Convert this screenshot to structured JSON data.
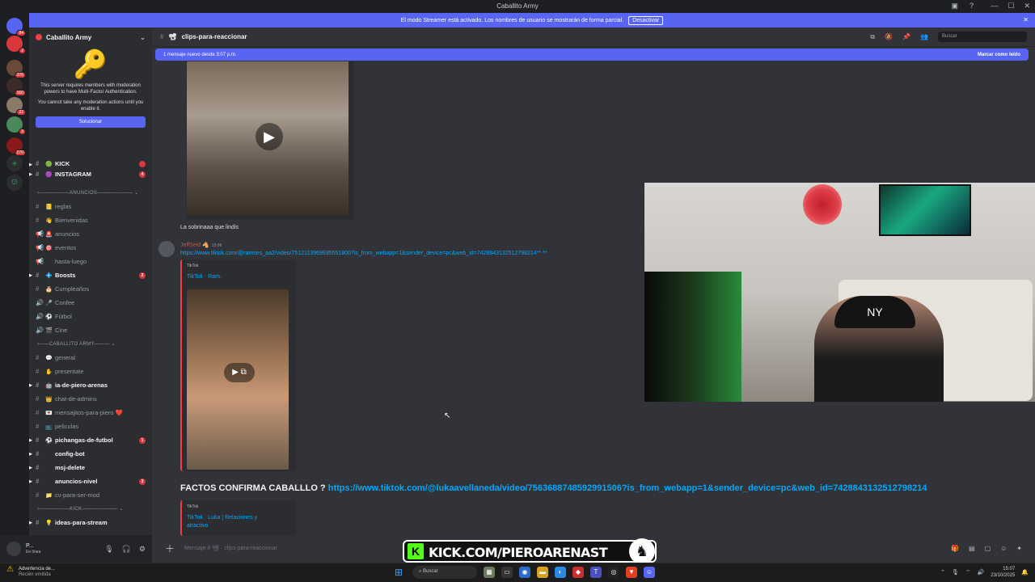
{
  "window": {
    "title": "Caballito Army"
  },
  "streamer_banner": {
    "text": "El modo Streamer está activado. Los nombres de usuario se mostrarán de forma parcial.",
    "button": "Desactivar"
  },
  "servers": [
    {
      "badge": "84"
    },
    {
      "badge": "2"
    },
    {
      "badge": "376"
    },
    {
      "badge": "160"
    },
    {
      "badge": "22"
    },
    {
      "badge": "3"
    },
    {
      "badge": "270"
    }
  ],
  "sidebar": {
    "guild_name": "Caballito Army",
    "mfa": {
      "line1": "This server requires members with moderation powers to have Multi-Factor Authentication.",
      "line2": "You cannot take any moderation actions until you enable it.",
      "button": "Solucionar"
    },
    "channels_top": [
      {
        "emoji": "🟢",
        "label": "KICK",
        "bold": true,
        "count": ""
      },
      {
        "emoji": "🟣",
        "label": "INSTAGRAM",
        "bold": true,
        "count": "4"
      }
    ],
    "cat_anuncios": "ANUNCIOS",
    "anuncios": [
      {
        "icon": "#",
        "emoji": "📒",
        "label": "reglas",
        "bold": false,
        "count": ""
      },
      {
        "icon": "#",
        "emoji": "👋",
        "label": "Bienvenidas",
        "bold": false,
        "count": ""
      },
      {
        "icon": "📢",
        "emoji": "🚨",
        "label": "anuncios",
        "bold": false,
        "count": ""
      },
      {
        "icon": "📢",
        "emoji": "🎯",
        "label": "eventos",
        "bold": false,
        "count": ""
      },
      {
        "icon": "📢",
        "emoji": "",
        "label": "hasta-luego",
        "bold": false,
        "count": ""
      },
      {
        "icon": "#",
        "emoji": "💠",
        "label": "Boosts",
        "bold": true,
        "count": "2"
      },
      {
        "icon": "#",
        "emoji": "🎂",
        "label": "Cumpleaños",
        "bold": false,
        "count": ""
      },
      {
        "icon": "🔊",
        "emoji": "🎤",
        "label": "Confee",
        "bold": false,
        "count": ""
      },
      {
        "icon": "🔊",
        "emoji": "⚽",
        "label": "Fútbol",
        "bold": false,
        "count": ""
      },
      {
        "icon": "🔊",
        "emoji": "🎬",
        "label": "Cine",
        "bold": false,
        "count": ""
      }
    ],
    "cat_caballito": "CABALLITO ARMY",
    "caballito": [
      {
        "icon": "#",
        "emoji": "💬",
        "label": "general",
        "bold": false,
        "count": ""
      },
      {
        "icon": "#",
        "emoji": "✋",
        "label": "presentate",
        "bold": false,
        "count": ""
      },
      {
        "icon": "#",
        "emoji": "🤖",
        "label": "ia-de-piero-arenas",
        "bold": true,
        "count": ""
      },
      {
        "icon": "#",
        "emoji": "👑",
        "label": "chat-de-admins",
        "bold": false,
        "count": ""
      },
      {
        "icon": "#",
        "emoji": "💌",
        "label": "mensajitos-para-piero ❤️",
        "bold": false,
        "count": ""
      },
      {
        "icon": "#",
        "emoji": "📺",
        "label": "peliculas",
        "bold": false,
        "count": ""
      },
      {
        "icon": "#",
        "emoji": "⚽",
        "label": "pichangas-de-futbol",
        "bold": true,
        "count": "1"
      },
      {
        "icon": "#",
        "emoji": "",
        "label": "config-bot",
        "bold": true,
        "count": ""
      },
      {
        "icon": "#",
        "emoji": "",
        "label": "msj-delete",
        "bold": true,
        "count": ""
      },
      {
        "icon": "#",
        "emoji": "",
        "label": "anuncios-nivel",
        "bold": true,
        "count": "3"
      },
      {
        "icon": "#",
        "emoji": "📁",
        "label": "cv-para-ser-mod",
        "bold": false,
        "count": ""
      }
    ],
    "cat_kick": "KICK",
    "kick": [
      {
        "icon": "#",
        "emoji": "💡",
        "label": "ideas-para-stream",
        "bold": true,
        "count": ""
      }
    ]
  },
  "user": {
    "name": "P...",
    "status": "En línea"
  },
  "channel_header": {
    "name": "clips-para-reaccionar",
    "search_placeholder": "Buscar"
  },
  "new_messages": {
    "text": "1 mensaje nuevo desde 3:07 p.m.",
    "action": "Marcar como leído"
  },
  "messages": {
    "caption1": "La sobrinaaa que lindis",
    "author": "JeffSeid",
    "time": "15:06",
    "link1": "https://www.tiktok.com/@ramses_aa2/video/7512113969935551800?is_from_webapp=1&sender_device=pc&web_id=7428843132512798214** **",
    "embed1_provider": "TikTok",
    "embed1_title": "TikTok · Ram.",
    "big_text": "FACTOS CONFIRMA CABALLLO ? ",
    "big_link": "https://www.tiktok.com/@lukaavellaneda/video/7563688748592991506?is_from_webapp=1&sender_device=pc&web_id=7428843132512798214",
    "embed2_provider": "TikTok",
    "embed2_title": "TikTok · Luka | Relaciones y atractivo"
  },
  "composer": {
    "placeholder": "Mensaje # 📽 · clips-para-reaccionar"
  },
  "kick_banner": {
    "text": "KICK.COM/PIEROARENAST"
  },
  "taskbar": {
    "warning_title": "Advertencia de...",
    "warning_sub": "Recién emitida",
    "search": "Buscar",
    "time": "15:07",
    "date": "23/10/2025"
  }
}
